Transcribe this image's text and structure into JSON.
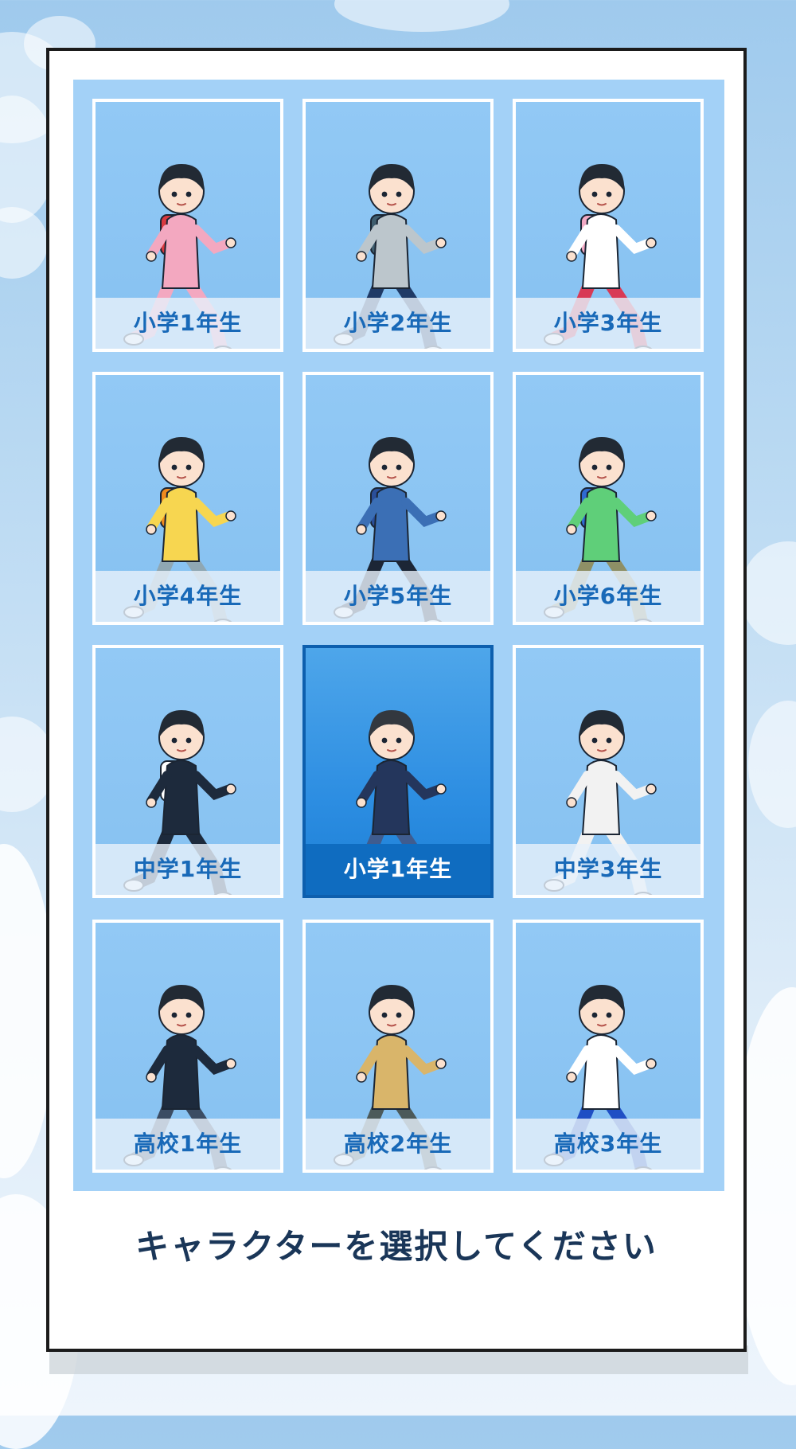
{
  "prompt": "キャラクターを選択してください",
  "characters": [
    {
      "label": "小学1年生",
      "hair": "#222a34",
      "top": "#f3a8c0",
      "bottom": "#f3a8c0",
      "bag": "#d8393f",
      "selected": false
    },
    {
      "label": "小学2年生",
      "hair": "#222a34",
      "top": "#bcc6cc",
      "bottom": "#1f3a66",
      "bag": "#3f5d6e",
      "selected": false
    },
    {
      "label": "小学3年生",
      "hair": "#222a34",
      "top": "#ffffff",
      "bottom": "#d83a55",
      "bag": "#f2a9c4",
      "selected": false
    },
    {
      "label": "小学4年生",
      "hair": "#222a34",
      "top": "#f7d650",
      "bottom": "#8fa7b3",
      "bag": "#f08a1e",
      "selected": false
    },
    {
      "label": "小学5年生",
      "hair": "#222a34",
      "top": "#3b6fb5",
      "bottom": "#1c2636",
      "bag": "#2a4f9a",
      "selected": false
    },
    {
      "label": "小学6年生",
      "hair": "#222a34",
      "top": "#5fcf79",
      "bottom": "#8e8f66",
      "bag": "#2f6ad2",
      "selected": false
    },
    {
      "label": "中学1年生",
      "hair": "#222a34",
      "top": "#1d2a3c",
      "bottom": "#1d2a3c",
      "bag": "#ffffff",
      "selected": false
    },
    {
      "label": "小学1年生",
      "hair": "#33383f",
      "top": "#24365c",
      "bottom": "#3f5c8f",
      "bag": "",
      "selected": true
    },
    {
      "label": "中学3年生",
      "hair": "#222a34",
      "top": "#f2f2f2",
      "bottom": "#f2f2f2",
      "bag": "",
      "selected": false
    },
    {
      "label": "高校1年生",
      "hair": "#222a34",
      "top": "#1d2a3c",
      "bottom": "#3b4c63",
      "bag": "",
      "selected": false
    },
    {
      "label": "高校2年生",
      "hair": "#222a34",
      "top": "#d9b56a",
      "bottom": "#4c5a5a",
      "bag": "",
      "selected": false
    },
    {
      "label": "高校3年生",
      "hair": "#222a34",
      "top": "#ffffff",
      "bottom": "#1f4fc4",
      "bag": "",
      "selected": false
    }
  ]
}
